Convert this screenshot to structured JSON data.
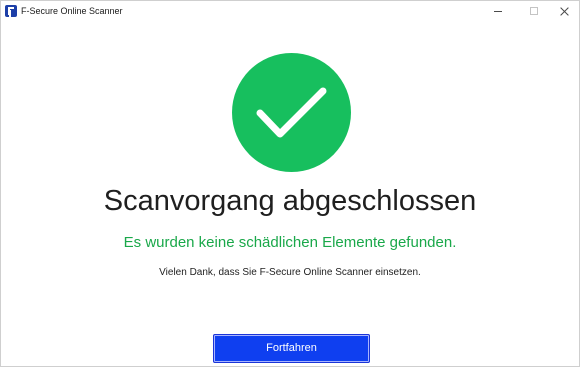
{
  "window": {
    "title": "F-Secure Online Scanner",
    "icon": "f-secure-logo-icon",
    "controls": [
      "minimize-icon",
      "maximize-icon",
      "close-icon"
    ]
  },
  "main": {
    "status_icon": "checkmark-icon",
    "heading": "Scanvorgang abgeschlossen",
    "result_message": "Es wurden keine schädlichen Elemente gefunden.",
    "thanks_message": "Vielen Dank, dass Sie F-Secure Online Scanner einsetzen.",
    "continue_label": "Fortfahren"
  },
  "colors": {
    "success_green": "#17bf5e",
    "result_text_green": "#1aa84a",
    "button_blue": "#0f3ff0",
    "brand_blue": "#1d3fa8"
  }
}
